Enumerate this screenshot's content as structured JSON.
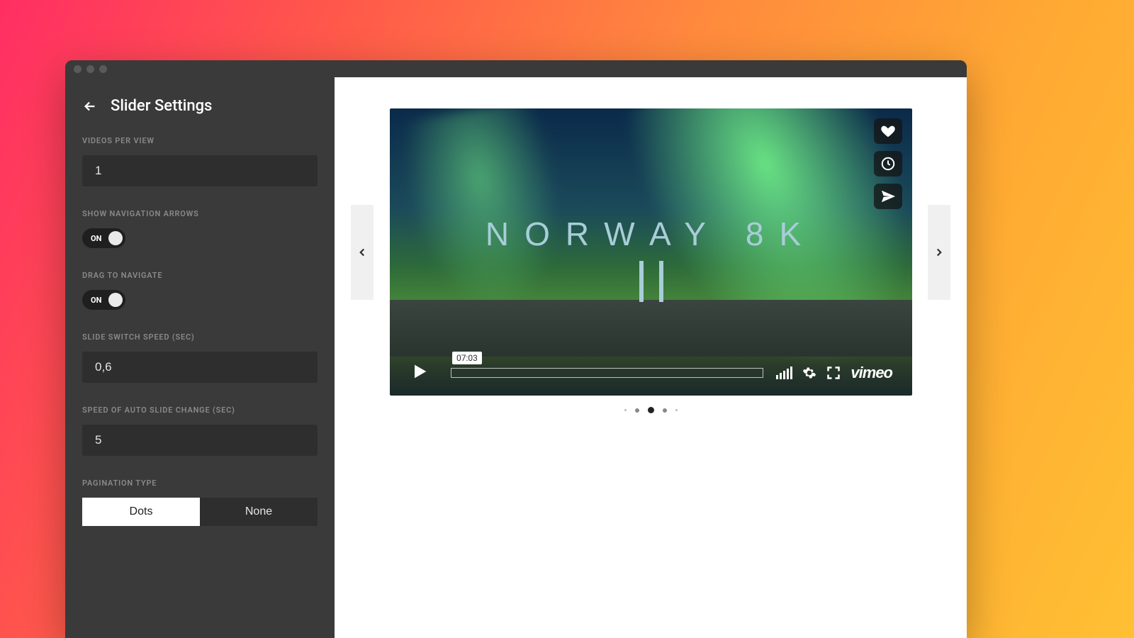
{
  "sidebar": {
    "title": "Slider Settings",
    "fields": {
      "videos_per_view": {
        "label": "VIDEOS PER VIEW",
        "value": "1"
      },
      "show_nav_arrows": {
        "label": "SHOW NAVIGATION ARROWS",
        "state": "ON"
      },
      "drag_to_navigate": {
        "label": "DRAG TO NAVIGATE",
        "state": "ON"
      },
      "slide_switch_speed": {
        "label": "SLIDE SWITCH SPEED (SEC)",
        "value": "0,6"
      },
      "auto_slide_speed": {
        "label": "SPEED OF AUTO SLIDE CHANGE (SEC)",
        "value": "5"
      },
      "pagination_type": {
        "label": "PAGINATION TYPE",
        "options": [
          "Dots",
          "None"
        ],
        "selected": "Dots"
      }
    }
  },
  "video": {
    "title_line1": "NORWAY 8K",
    "time_tooltip": "07:03",
    "provider": "vimeo"
  },
  "pagination": {
    "count": 5,
    "active_index": 2
  }
}
